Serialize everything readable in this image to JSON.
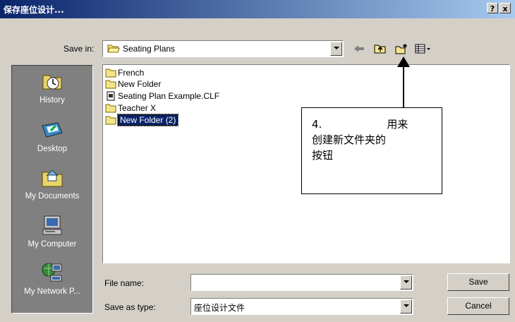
{
  "window": {
    "title": "保存座位设计...",
    "help_label": "?",
    "close_label": "x"
  },
  "save_in": {
    "label": "Save in:",
    "value": "Seating Plans"
  },
  "toolbar": {
    "icons": [
      "back-arrow-icon",
      "up-folder-icon",
      "new-folder-icon",
      "views-menu-icon"
    ]
  },
  "places": [
    {
      "label": "History",
      "icon": "history-icon"
    },
    {
      "label": "Desktop",
      "icon": "desktop-icon"
    },
    {
      "label": "My Documents",
      "icon": "my-documents-icon"
    },
    {
      "label": "My Computer",
      "icon": "my-computer-icon"
    },
    {
      "label": "My Network P...",
      "icon": "my-network-icon"
    }
  ],
  "files": [
    {
      "name": "French",
      "type": "folder"
    },
    {
      "name": "New Folder",
      "type": "folder"
    },
    {
      "name": "Seating Plan Example.CLF",
      "type": "file"
    },
    {
      "name": "Teacher X",
      "type": "folder"
    },
    {
      "name": "New Folder (2)",
      "type": "folder",
      "editing": true
    }
  ],
  "file_name": {
    "label": "File name:",
    "value": ""
  },
  "save_as_type": {
    "label": "Save as type:",
    "value": "座位设计文件"
  },
  "buttons": {
    "save": "Save",
    "cancel": "Cancel"
  },
  "annotation": {
    "number": "4.",
    "text_line1": "用来",
    "text_line2": "创建新文件夹的",
    "text_line3": "按钮"
  }
}
